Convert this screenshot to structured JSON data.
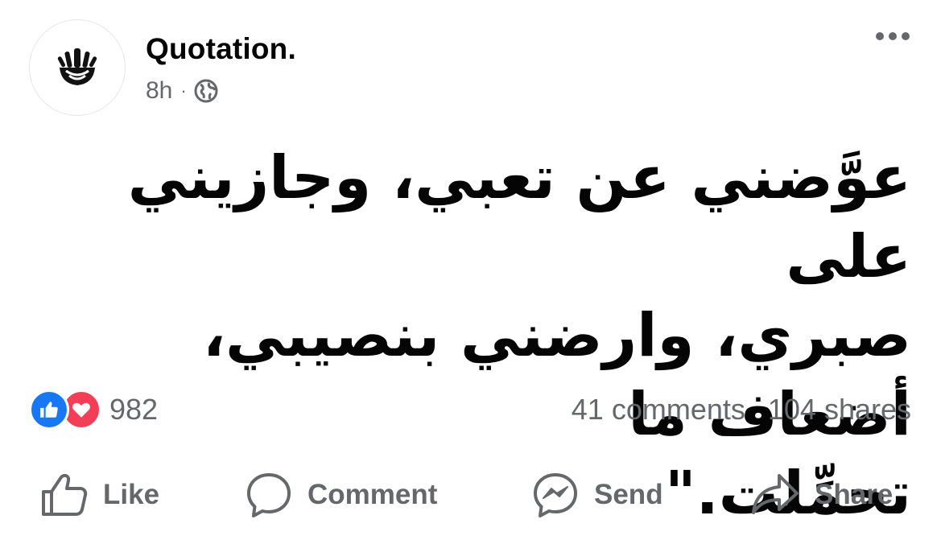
{
  "post": {
    "page_name": "Quotation.",
    "time": "8h",
    "separator": "·",
    "audience_icon": "globe-icon",
    "quote_lines": [
      "عوَّضني عن تعبي، وجازيني على",
      "صبري، وارضني بنصيبي، أضعاف ما",
      "تحمِّلت.\""
    ]
  },
  "engagement": {
    "reaction_icons": [
      "like-reaction-icon",
      "love-reaction-icon"
    ],
    "reaction_count": "982",
    "comments": "41 comments",
    "shares": "104 shares"
  },
  "actions": {
    "like": "Like",
    "comment": "Comment",
    "send": "Send",
    "share": "Share"
  },
  "colors": {
    "like_blue": "#1877f2",
    "love_red": "#f33e58",
    "secondary_text": "#65676b",
    "primary_text": "#050505"
  }
}
